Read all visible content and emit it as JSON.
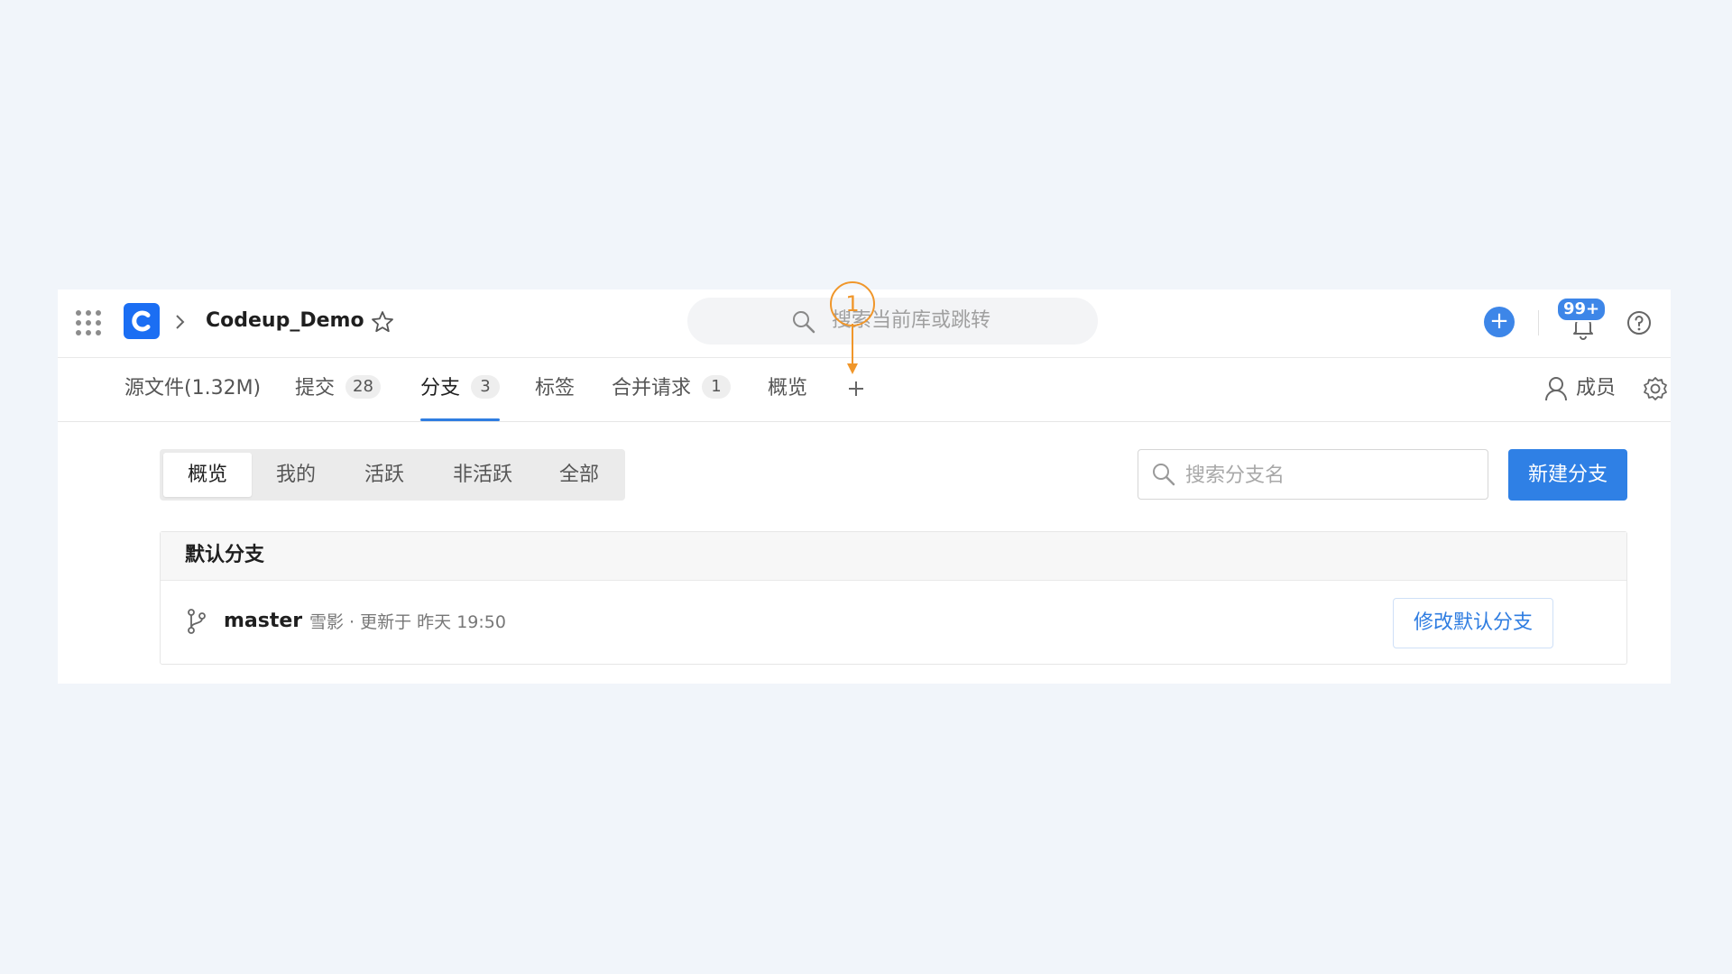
{
  "topbar": {
    "repo_name": "Codeup_Demo",
    "search_placeholder": "搜索当前库或跳转",
    "notification_badge": "99+"
  },
  "tabs": [
    {
      "label": "源文件(1.32M)",
      "count": null,
      "active": false
    },
    {
      "label": "提交",
      "count": "28",
      "active": false
    },
    {
      "label": "分支",
      "count": "3",
      "active": true
    },
    {
      "label": "标签",
      "count": null,
      "active": false
    },
    {
      "label": "合并请求",
      "count": "1",
      "active": false
    },
    {
      "label": "概览",
      "count": null,
      "active": false
    }
  ],
  "members_label": "成员",
  "filters": [
    {
      "label": "概览",
      "active": true
    },
    {
      "label": "我的",
      "active": false
    },
    {
      "label": "活跃",
      "active": false
    },
    {
      "label": "非活跃",
      "active": false
    },
    {
      "label": "全部",
      "active": false
    }
  ],
  "branch_search_placeholder": "搜索分支名",
  "new_branch_label": "新建分支",
  "default_branch": {
    "section_title": "默认分支",
    "name": "master",
    "meta": "雪影 · 更新于 昨天 19:50",
    "edit_label": "修改默认分支"
  },
  "annotation": {
    "number": "1",
    "color": "#f0962a"
  },
  "colors": {
    "accent": "#2f80e5",
    "logo": "#1b6ef3"
  }
}
